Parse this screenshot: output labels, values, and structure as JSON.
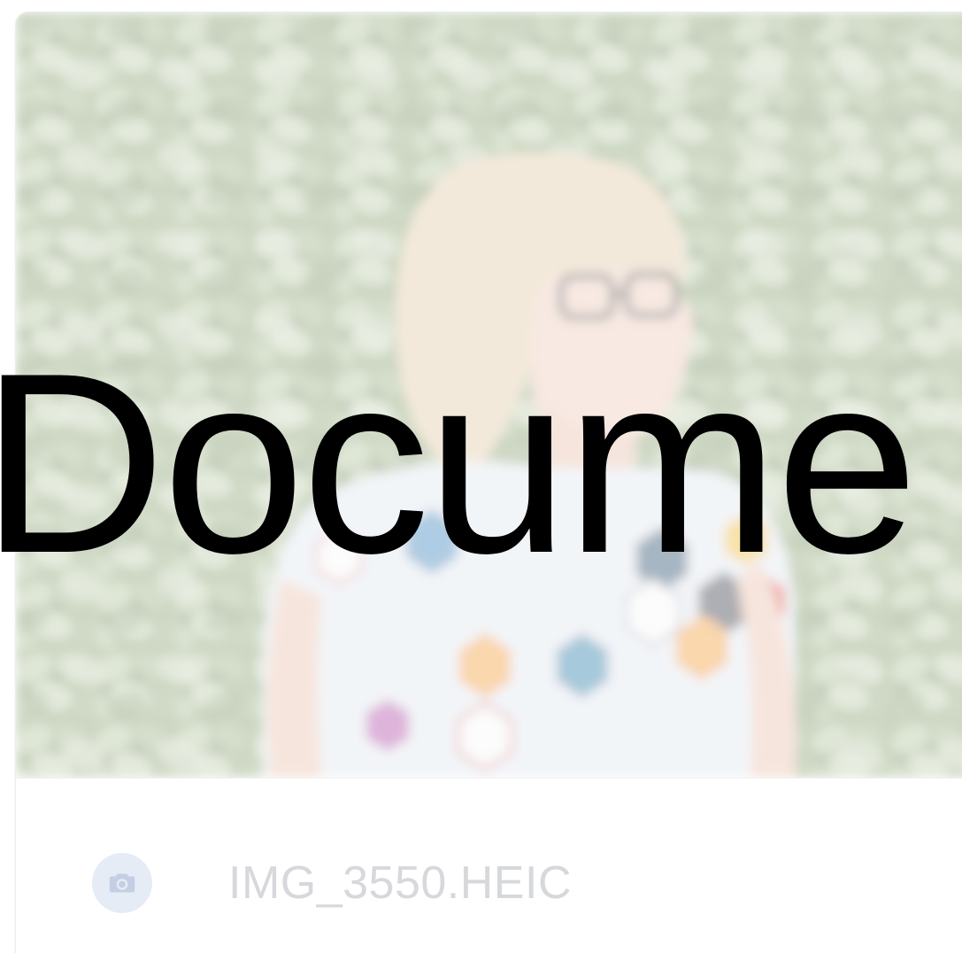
{
  "overlay": {
    "text": "Docume"
  },
  "card": {
    "image_alt": "Photo of a person with glasses in front of green ivy",
    "filename": "IMG_3550.HEIC",
    "file_icon": "camera-icon"
  },
  "colors": {
    "filename_text": "#d6d8dc",
    "icon_badge": "#e6ecf6",
    "icon_glyph": "#c3cfe3",
    "overlay_text": "#000000"
  }
}
